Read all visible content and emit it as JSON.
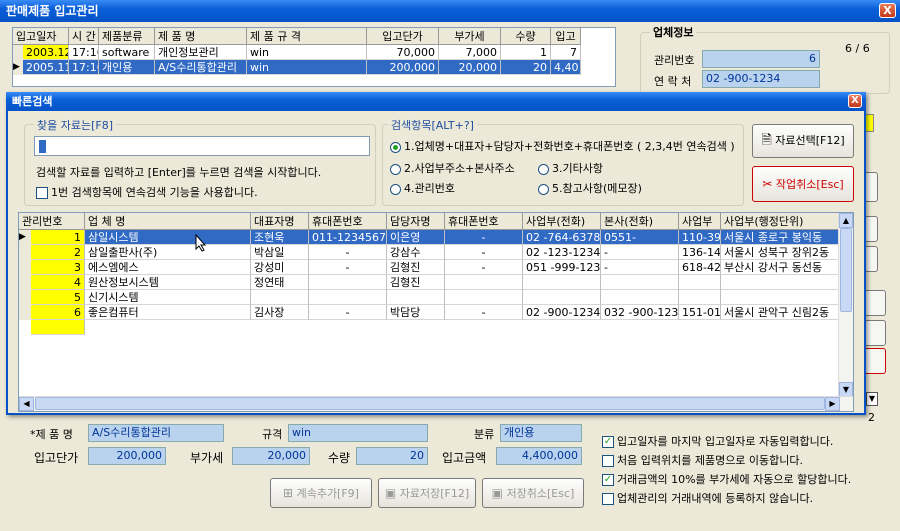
{
  "main_window": {
    "title": "판매제품 입고관리",
    "close_label": "X",
    "table": {
      "headers": [
        "입고일자",
        "시 간",
        "제품분류",
        "제 품 명",
        "제 품 규 격",
        "입고단가",
        "부가세",
        "수량",
        "입고"
      ],
      "rows": [
        [
          "2003.12.24",
          "17:16",
          "software",
          "개인정보관리",
          "win",
          "70,000",
          "7,000",
          "1",
          "7"
        ],
        [
          "2005.11.21",
          "17:16",
          "개인용",
          "A/S수리통합관리",
          "win",
          "200,000",
          "20,000",
          "20",
          "4,40"
        ]
      ]
    },
    "vendor_info": {
      "title": "업체정보",
      "mgmt_label": "관리번호",
      "mgmt_value": "6",
      "counter": "6 / 6",
      "contact_label": "연 락 처",
      "contact_value": "02    -900-1234"
    },
    "form": {
      "product_label": "*제 품 명",
      "product_value": "A/S수리통합관리",
      "spec_label": "규격",
      "spec_value": "win",
      "category_label": "분류",
      "category_value": "개인용",
      "unit_price_label": "입고단가",
      "unit_price_value": "200,000",
      "vat_label": "부가세",
      "vat_value": "20,000",
      "qty_label": "수량",
      "qty_value": "20",
      "amount_label": "입고금액",
      "amount_value": "4,400,000"
    },
    "buttons": {
      "continue_add": "계속추가[F9]",
      "save": "자료저장[F12]",
      "cancel_save": "저장취소[Esc]"
    },
    "options": [
      {
        "label": "입고일자를 마지막 입고일자로 자동입력합니다.",
        "checked": true
      },
      {
        "label": "처음 입력위치를 제품명으로 이동합니다.",
        "checked": false
      },
      {
        "label": "거래금액의 10%를 부가세에 자동으로 할당합니다.",
        "checked": true
      },
      {
        "label": "업체관리의 거래내역에 등록하지 않습니다.",
        "checked": false
      }
    ],
    "side_digit": "2"
  },
  "quick_search": {
    "title": "빠른검색",
    "close_label": "X",
    "search_group_title": "찾을 자료는[F8]",
    "search_value": "",
    "search_hint": "검색할 자료를 입력하고 [Enter]를 누르면 검색을 시작합니다.",
    "continuous_label": "1번 검색항목에 연속검색 기능을 사용합니다.",
    "criteria_title": "검색항목[ALT+?]",
    "criteria": [
      {
        "label": "1.업체명+대표자+담당자+전화번호+휴대폰번호 ( 2,3,4번 연속검색 )",
        "selected": true
      },
      {
        "label": "2.사업부주소+본사주소",
        "selected": false
      },
      {
        "label": "3.기타사항",
        "selected": false
      },
      {
        "label": "4.관리번호",
        "selected": false
      },
      {
        "label": "5.참고사항(메모장)",
        "selected": false
      }
    ],
    "select_button": "자료선택[F12]",
    "cancel_button": "작업취소[Esc]",
    "grid": {
      "headers": [
        "관리번호",
        "업 체 명",
        "대표자명",
        "휴대폰번호",
        "담당자명",
        "휴대폰번호",
        "사업부(전화)",
        "본사(전화)",
        "사업부",
        "사업부(행정단위)"
      ],
      "rows": [
        [
          "1",
          "삼일시스템",
          "조현욱",
          "011-1234567",
          "이은영",
          "-",
          "02   -764-6378",
          "0551-",
          "110-390",
          "서울시 종로구 봉익동"
        ],
        [
          "2",
          "삼일출판사(주)",
          "박삼일",
          "-",
          "강삼수",
          "-",
          "02   -123-1234",
          "-",
          "136-142",
          "서울시 성북구 장위2동"
        ],
        [
          "3",
          "에스엠에스",
          "강성미",
          "-",
          "김형진",
          "-",
          "051  -999-1234",
          "-",
          "618-420",
          "부산시 강서구 동선동"
        ],
        [
          "4",
          "원산정보시스템",
          "정연태",
          "",
          "김형진",
          "",
          "",
          "",
          "",
          ""
        ],
        [
          "5",
          "신기시스템",
          "",
          "",
          "",
          "",
          "",
          "",
          "",
          ""
        ],
        [
          "6",
          "좋은컴퓨터",
          "김사장",
          "-",
          "박담당",
          "-",
          "02   -900-1234",
          "032  -900-1234",
          "151-012",
          "서울시 관악구 신림2동"
        ]
      ]
    }
  },
  "colors": {
    "titlebar": "#0553c6",
    "selection": "#316ac5",
    "highlight": "#ffff00",
    "field_bg": "#b9d3ee"
  }
}
